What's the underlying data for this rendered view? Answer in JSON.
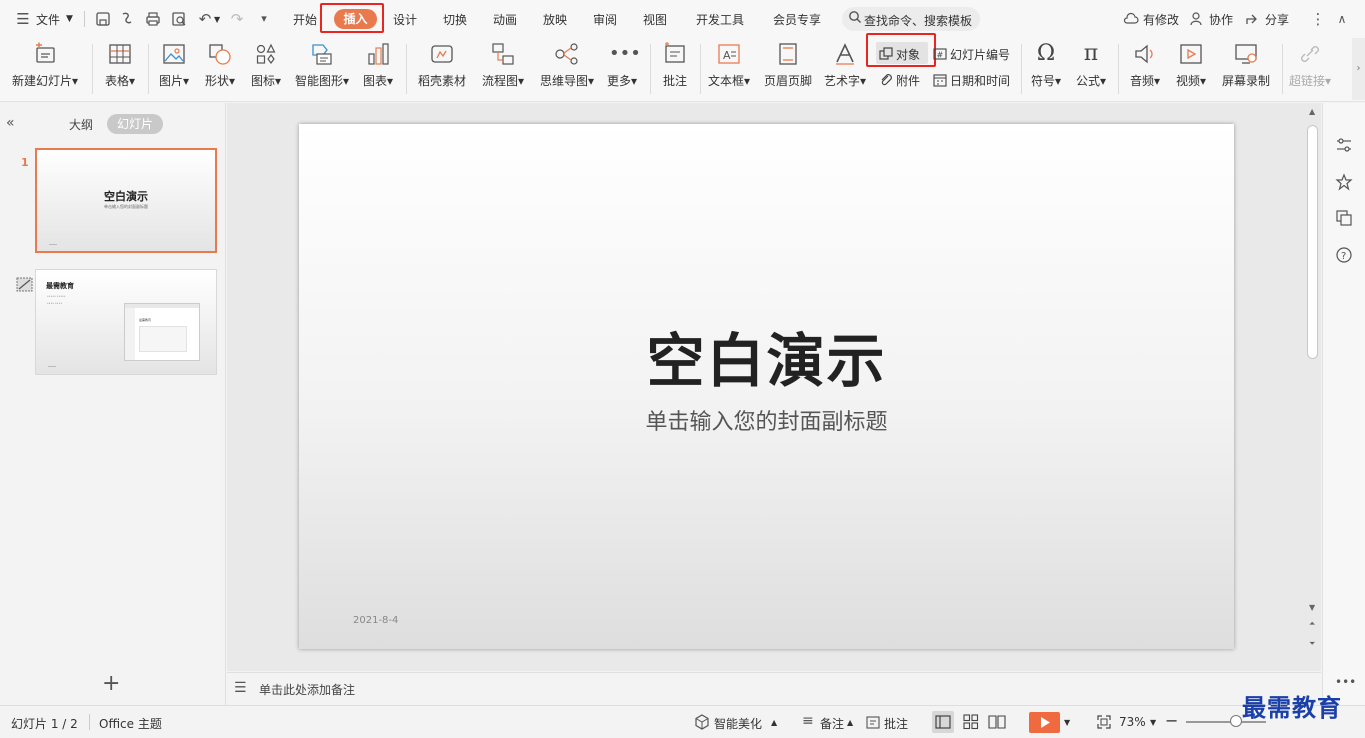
{
  "menu": {
    "file": "文件",
    "tabs": [
      "开始",
      "插入",
      "设计",
      "切换",
      "动画",
      "放映",
      "审阅",
      "视图",
      "开发工具",
      "会员专享"
    ],
    "search_placeholder": "查找命令、搜索模板",
    "modified": "有修改",
    "collab": "协作",
    "share": "分享"
  },
  "ribbon": {
    "new_slide": "新建幻灯片",
    "table": "表格",
    "picture": "图片",
    "shape": "形状",
    "icon": "图标",
    "smart_shape": "智能图形",
    "chart": "图表",
    "material": "稻壳素材",
    "flowchart": "流程图",
    "mindmap": "思维导图",
    "more": "更多",
    "comment": "批注",
    "textbox": "文本框",
    "header_footer": "页眉页脚",
    "wordart": "艺术字",
    "object": "对象",
    "attachment": "附件",
    "slide_number": "幻灯片编号",
    "datetime": "日期和时间",
    "symbol": "符号",
    "formula": "公式",
    "audio": "音频",
    "video": "视频",
    "screen_record": "屏幕录制",
    "hyperlink": "超链接"
  },
  "left_panel": {
    "outline_tab": "大纲",
    "slides_tab": "幻灯片",
    "thumbs": [
      {
        "number": "1",
        "title": "空白演示",
        "subtitle": "单击输入您的封面副标题"
      },
      {
        "title": "最需教育",
        "bullets": [
          "••••• •••••",
          "•••• ••••"
        ],
        "inner_title": "最需教育"
      }
    ]
  },
  "slide": {
    "title": "空白演示",
    "subtitle": "单击输入您的封面副标题",
    "date": "2021-8-4"
  },
  "notes": {
    "placeholder": "单击此处添加备注"
  },
  "status": {
    "slide_count": "幻灯片 1 / 2",
    "theme": "Office 主题",
    "beautify": "智能美化",
    "notes": "备注",
    "comment": "批注",
    "zoom": "73%"
  },
  "watermark": "最需教育",
  "colors": {
    "accent": "#e97a4e",
    "highlight": "#e8261f",
    "play": "#ef6a3e"
  }
}
